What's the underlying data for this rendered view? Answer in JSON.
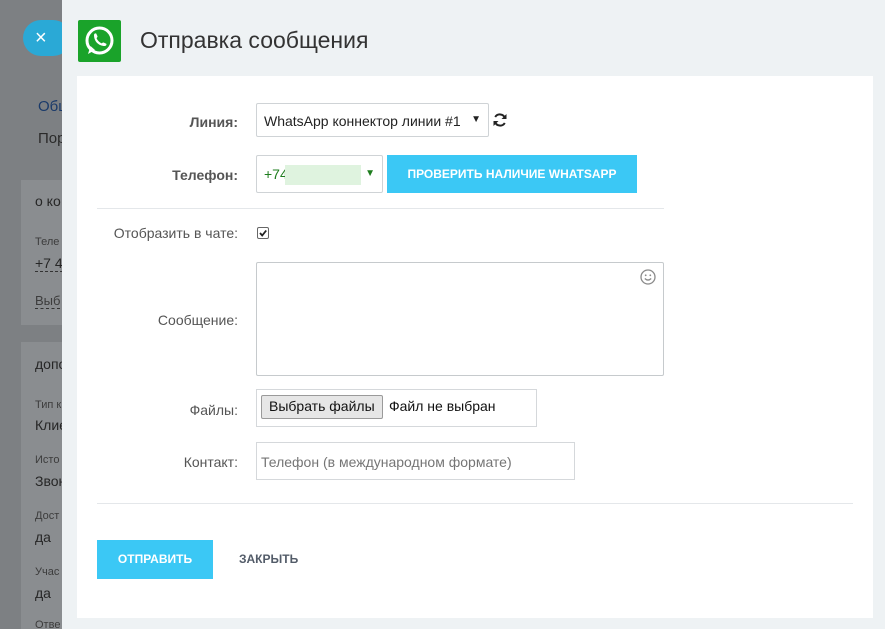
{
  "background": {
    "close_glyph": "×",
    "tab_label": "Общ",
    "tab_sub": "Пор",
    "section1_title": "о ко",
    "phone_label": "Теле",
    "phone_value": "+7 4",
    "choose_label": "Выб",
    "section2_title": "допо",
    "type_label": "Тип к",
    "type_value": "Клие",
    "source_label": "Исто",
    "source_value": "Звон",
    "access_label": "Дост",
    "access_value": "да",
    "participant_label": "Учас",
    "participant_value": "да",
    "resp_label": "Отве"
  },
  "header": {
    "title": "Отправка сообщения",
    "logo_icon": "whatsapp-icon",
    "brand_color": "#1aa32a"
  },
  "form": {
    "line_label": "Линия:",
    "line_value": "WhatsApp коннектор линии #1",
    "phone_label": "Телефон:",
    "phone_value": "+74",
    "check_button": "ПРОВЕРИТЬ НАЛИЧИЕ WHATSAPP",
    "show_in_chat_label": "Отобразить в чате:",
    "show_in_chat_checked": true,
    "message_label": "Сообщение:",
    "message_value": "",
    "files_label": "Файлы:",
    "choose_files_button": "Выбрать файлы",
    "no_file_text": "Файл не выбран",
    "contact_label": "Контакт:",
    "contact_placeholder": "Телефон (в международном формате)"
  },
  "footer": {
    "send_button": "ОТПРАВИТЬ",
    "close_button": "ЗАКРЫТЬ"
  },
  "colors": {
    "accent": "#3bc8f5",
    "phone_text": "#1e7d1e"
  }
}
